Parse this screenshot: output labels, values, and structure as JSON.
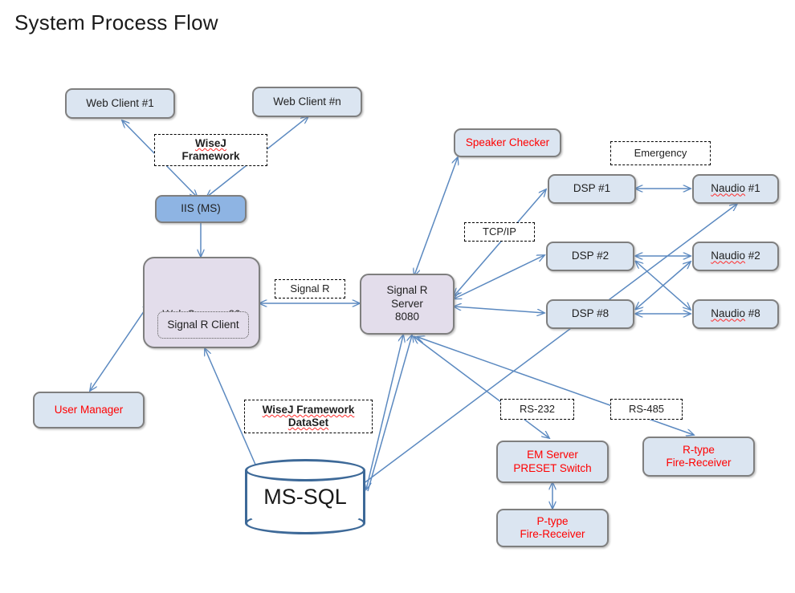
{
  "page": {
    "title": "System Process Flow",
    "background": "#ffffff"
  },
  "colors": {
    "node_blue_fill": "#dbe5f1",
    "node_iis_fill": "#8eb4e3",
    "node_lavender_fill": "#e3ddeb",
    "node_border": "#7f7f7f",
    "edge": "#5b89c0",
    "red_text": "#ff0000",
    "db_outline": "#3d6998",
    "dark_text": "#1f1f1f"
  },
  "nodes": {
    "web_client_1": "Web Client #1",
    "web_client_n": "Web Client #n",
    "iis": "IIS (MS)",
    "web_server": "Web Server : 80",
    "signalr_client": "Signal R Client",
    "user_manager": "User Manager",
    "signalr_server_line1": "Signal R",
    "signalr_server_line2": "Server",
    "signalr_server_line3": "8080",
    "speaker_checker": "Speaker Checker",
    "dsp_1": "DSP #1",
    "dsp_2": "DSP #2",
    "dsp_8": "DSP #8",
    "naudio_1_word": "Naudio",
    "naudio_1_num": " #1",
    "naudio_2_word": "Naudio",
    "naudio_2_num": " #2",
    "naudio_8_word": "Naudio",
    "naudio_8_num": " #8",
    "em_server_line1": "EM Server",
    "em_server_line2": "PRESET Switch",
    "p_type_line1": "P-type",
    "p_type_line2": "Fire-Receiver",
    "r_type_line1": "R-type",
    "r_type_line2": "Fire-Receiver",
    "ms_sql": "MS-SQL"
  },
  "labels": {
    "wisej_framework_line1": "WiseJ",
    "wisej_framework_line2": "Framework",
    "signalr": "Signal R",
    "wisej_dataset_line1": "WiseJ Framework",
    "wisej_dataset_line2": "DataSet",
    "emergency": "Emergency",
    "tcpip": "TCP/IP",
    "rs232": "RS-232",
    "rs485": "RS-485"
  },
  "diagram_data": {
    "type": "flow-diagram",
    "edges": [
      {
        "from": "iis",
        "to": "web_client_1",
        "direction": "both"
      },
      {
        "from": "iis",
        "to": "web_client_n",
        "direction": "both"
      },
      {
        "from": "iis",
        "to": "web_server",
        "direction": "to"
      },
      {
        "from": "web_server",
        "to": "user_manager",
        "direction": "both"
      },
      {
        "from": "web_server",
        "to": "signalr_server",
        "direction": "both",
        "label": "Signal R"
      },
      {
        "from": "ms_sql",
        "to": "web_server",
        "direction": "both"
      },
      {
        "from": "signalr_server",
        "to": "speaker_checker",
        "direction": "both"
      },
      {
        "from": "signalr_server",
        "to": "dsp_1",
        "direction": "both",
        "label": "TCP/IP"
      },
      {
        "from": "signalr_server",
        "to": "dsp_2",
        "direction": "both",
        "label": "TCP/IP"
      },
      {
        "from": "signalr_server",
        "to": "dsp_8",
        "direction": "both",
        "label": "TCP/IP"
      },
      {
        "from": "signalr_server",
        "to": "ms_sql",
        "direction": "both"
      },
      {
        "from": "signalr_server",
        "to": "em_server",
        "direction": "to",
        "label": "RS-232"
      },
      {
        "from": "signalr_server",
        "to": "r_type",
        "direction": "to",
        "label": "RS-485"
      },
      {
        "from": "dsp_1",
        "to": "naudio_1",
        "direction": "both"
      },
      {
        "from": "dsp_2",
        "to": "naudio_2",
        "direction": "both"
      },
      {
        "from": "dsp_8",
        "to": "naudio_8",
        "direction": "both"
      },
      {
        "from": "dsp_2",
        "to": "naudio_8",
        "direction": "both"
      },
      {
        "from": "dsp_8",
        "to": "naudio_2",
        "direction": "both"
      },
      {
        "from": "ms_sql",
        "to": "naudio_1",
        "direction": "to"
      },
      {
        "from": "em_server",
        "to": "p_type",
        "direction": "both"
      }
    ]
  }
}
